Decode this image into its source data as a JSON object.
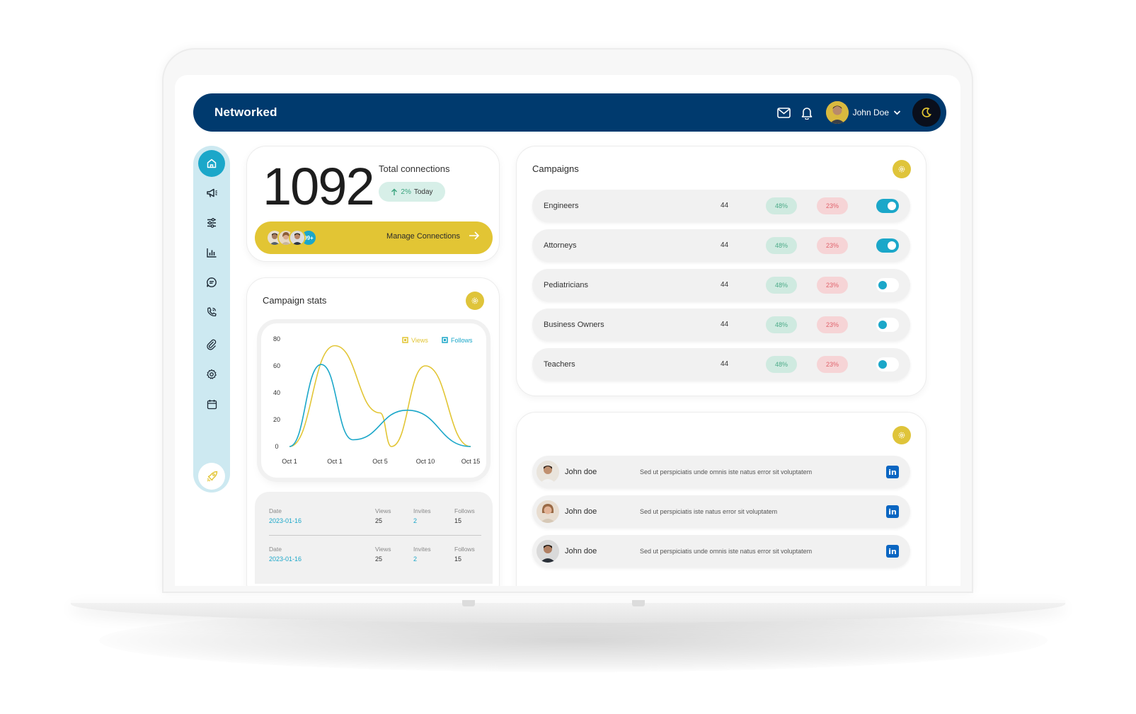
{
  "app": {
    "brand": "Networked"
  },
  "header": {
    "user_name": "John Doe",
    "icons": [
      "mail-icon",
      "bell-icon",
      "chevron-down-icon",
      "moon-icon"
    ]
  },
  "sidebar": {
    "items": [
      {
        "icon": "home-icon",
        "active": true
      },
      {
        "icon": "megaphone-icon"
      },
      {
        "icon": "sliders-icon"
      },
      {
        "icon": "bar-chart-icon"
      },
      {
        "icon": "message-icon"
      },
      {
        "icon": "phone-icon"
      },
      {
        "icon": "paperclip-icon"
      },
      {
        "icon": "gear-icon"
      },
      {
        "icon": "calendar-icon"
      }
    ],
    "bottom_icon": "rocket-icon"
  },
  "connections": {
    "total": "1092",
    "label": "Total connections",
    "change": "2%",
    "change_period": "Today",
    "avatar_count": "99+",
    "manage_label": "Manage Connections"
  },
  "campaign_stats": {
    "title": "Campaign stats",
    "rows": [
      {
        "date_label": "Date",
        "date": "2023-01-16",
        "views_label": "Views",
        "views": "25",
        "invites_label": "Invites",
        "invites": "2",
        "follows_label": "Follows",
        "follows": "15"
      },
      {
        "date_label": "Date",
        "date": "2023-01-16",
        "views_label": "Views",
        "views": "25",
        "invites_label": "Invites",
        "invites": "2",
        "follows_label": "Follows",
        "follows": "15"
      }
    ]
  },
  "chart_data": {
    "type": "line",
    "x_labels": [
      "Oct 1",
      "Oct 1",
      "Oct 5",
      "Oct 10",
      "Oct 15"
    ],
    "y_ticks": [
      0,
      20,
      40,
      60,
      80
    ],
    "ylim": [
      0,
      80
    ],
    "legend_position": "top-right",
    "smooth": true,
    "series": [
      {
        "name": "Views",
        "color": "#e2c534",
        "x": [
          0,
          1,
          2,
          2.25,
          3,
          4
        ],
        "y": [
          0,
          75,
          25,
          0,
          60,
          0
        ]
      },
      {
        "name": "Follows",
        "color": "#1ba7c9",
        "x": [
          0,
          0.7,
          1.4,
          2.6,
          4
        ],
        "y": [
          0,
          61,
          5,
          27,
          0
        ]
      }
    ]
  },
  "campaigns": {
    "title": "Campaigns",
    "rows": [
      {
        "name": "Engineers",
        "count": "44",
        "positive": "48%",
        "negative": "23%",
        "enabled": true
      },
      {
        "name": "Attorneys",
        "count": "44",
        "positive": "48%",
        "negative": "23%",
        "enabled": true
      },
      {
        "name": "Pediatricians",
        "count": "44",
        "positive": "48%",
        "negative": "23%",
        "enabled": false
      },
      {
        "name": "Business Owners",
        "count": "44",
        "positive": "48%",
        "negative": "23%",
        "enabled": false
      },
      {
        "name": "Teachers",
        "count": "44",
        "positive": "48%",
        "negative": "23%",
        "enabled": false
      }
    ]
  },
  "messages": {
    "rows": [
      {
        "name": "John doe",
        "text": "Sed ut perspiciatis unde omnis iste natus error sit voluptatem",
        "icon": "linkedin-icon"
      },
      {
        "name": "John doe",
        "text": "Sed ut perspiciatis iste natus error sit voluptatem",
        "icon": "linkedin-icon"
      },
      {
        "name": "John doe",
        "text": "Sed ut perspiciatis unde omnis iste natus error sit voluptatem",
        "icon": "linkedin-icon"
      }
    ]
  },
  "colors": {
    "navbar": "#003a6e",
    "accent_yellow": "#e2c534",
    "accent_teal": "#1ba7c9",
    "positive": "#4cab88",
    "negative": "#e0636c",
    "linkedin": "#0a66c2"
  }
}
